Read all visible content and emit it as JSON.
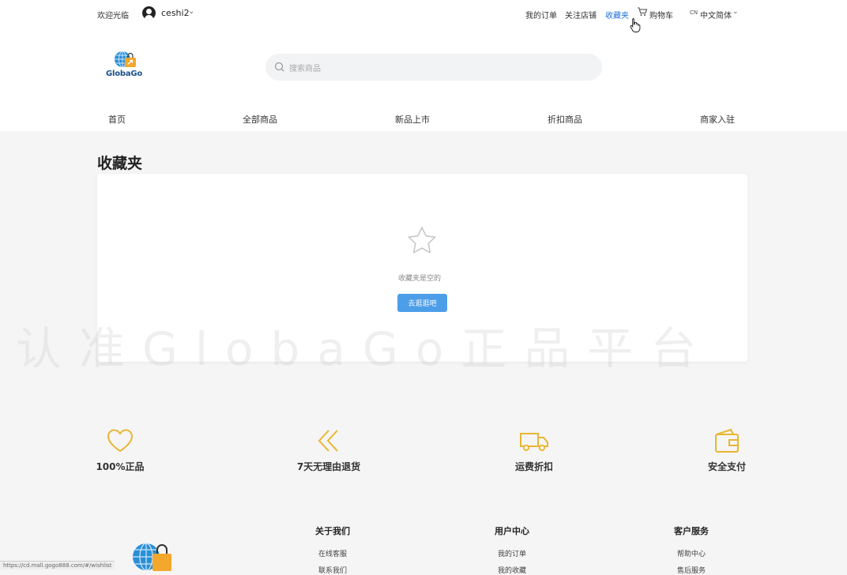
{
  "topbar": {
    "welcome": "欢迎光临",
    "username": "ceshi2",
    "links": [
      "我的订单",
      "关注店铺",
      "收藏夹",
      "购物车"
    ],
    "lang_badge": "CN",
    "lang": "中文简体"
  },
  "brand": {
    "logo_text": "GlobaGo",
    "footer_logo_icon": "globe-bag-logo-icon"
  },
  "search": {
    "placeholder": "搜索商品"
  },
  "nav": [
    "首页",
    "全部商品",
    "新品上市",
    "折扣商品",
    "商家入驻"
  ],
  "page": {
    "title": "收藏夹",
    "empty_text": "收藏夹是空的",
    "go_button": "去逛逛吧"
  },
  "watermark": "认准GlobaGo正品平台",
  "features": [
    {
      "label": "100%正品",
      "icon": "heart-icon"
    },
    {
      "label": "7天无理由退货",
      "icon": "double-chevron-left-icon"
    },
    {
      "label": "运费折扣",
      "icon": "truck-icon"
    },
    {
      "label": "安全支付",
      "icon": "wallet-icon"
    }
  ],
  "footer": {
    "columns": [
      {
        "heading": "关于我们",
        "links": [
          "在线客服",
          "联系我们"
        ]
      },
      {
        "heading": "用户中心",
        "links": [
          "我的订单",
          "我的收藏"
        ]
      },
      {
        "heading": "客户服务",
        "links": [
          "帮助中心",
          "售后服务"
        ]
      }
    ]
  },
  "status_url": "https://cd.mall.gogo888.com/#/wishlist",
  "colors": {
    "accent": "#1d6fd8",
    "button": "#4d9ee9",
    "icon_gold": "#e9b632",
    "background": "#f5f5f5"
  }
}
